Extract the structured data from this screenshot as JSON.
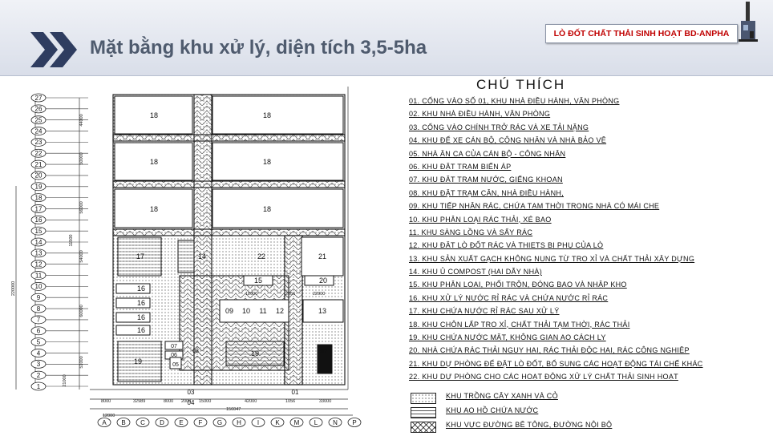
{
  "header": {
    "title": "Mặt bằng khu xử lý, diện tích 3,5-5ha",
    "badge": "LÒ ĐỐT CHẤT THẢI SINH HOẠT BD-ANPHA",
    "logo_icon": "double-chevron-icon",
    "colors": {
      "title": "#4f5b6e",
      "badge_text": "#c00000",
      "chevron": "#2f3d60"
    }
  },
  "plan": {
    "row_labels": [
      "27",
      "26",
      "25",
      "24",
      "23",
      "22",
      "21",
      "20",
      "19",
      "18",
      "17",
      "16",
      "15",
      "14",
      "13",
      "12",
      "11",
      "10",
      "9",
      "8",
      "7",
      "6",
      "5",
      "4",
      "3",
      "2",
      "1"
    ],
    "col_labels": [
      "A",
      "B",
      "C",
      "D",
      "E",
      "F",
      "G",
      "H",
      "I",
      "K",
      "M",
      "L",
      "N",
      "P"
    ],
    "vertical_dims": [
      "44000",
      "50000",
      "56000",
      "54000",
      "60000",
      "51000",
      "21000"
    ],
    "overall_height": "220000",
    "horizontal_dims": [
      "8000",
      "32989",
      "8000",
      "2000",
      "15000",
      "42000",
      "1056",
      "33000"
    ],
    "overall_width": "156047",
    "left_offset": "12000",
    "dim_12000": "12000",
    "dim_2056": "2056",
    "dim_22000": "22000",
    "zones": {
      "z18": "18",
      "z17": "17",
      "z14": "14",
      "z22": "22",
      "z21": "21",
      "z15": "15",
      "z20": "20",
      "z16": "16",
      "z09": "09",
      "z10": "10",
      "z11": "11",
      "z12": "12",
      "z13": "13",
      "z19": "19",
      "z07": "07",
      "z06": "06",
      "z05": "05",
      "z08": "08",
      "z03": "03",
      "z04": "04",
      "z02": "02",
      "z01": "01"
    }
  },
  "legend": {
    "title": "CHÚ THÍCH",
    "items": [
      "01. CỔNG VÀO SỐ 01, KHU NHÀ ĐIỀU HÀNH, VĂN PHÒNG",
      "02. KHU NHÀ ĐIỀU HÀNH, VĂN PHÒNG",
      "03. CỔNG VÀO CHÍNH TRỞ RÁC VÀ XE TẢI NẶNG",
      "04. KHU ĐỂ XE CÁN BỘ, CÔNG NHÂN VÀ NHÀ BẢO VỆ",
      "05. NHÀ ĂN CA CỦA CÁN BỘ - CÔNG NHÂN",
      "06. KHU ĐẶT TRẠM BIẾN ÁP",
      "07. KHU ĐẶT TRẠM NƯỚC, GIẾNG KHOAN",
      "08. KHU ĐẶT TRẠM CÂN, NHÀ ĐIỀU HÀNH,",
      "09. KHU TIẾP NHẬN RÁC, CHỨA TẠM THỜI TRONG NHÀ CÓ MÁI CHE",
      "10. KHU PHÂN LOẠI RÁC THẢI, XÉ BAO",
      "11. KHU SÀNG LỒNG VÀ SẤY RÁC",
      "12. KHU ĐẶT LÒ ĐỐT RÁC VÀ THIETS BỊ PHỤ CỦA LÒ",
      "13. KHU SẢN XUẤT GẠCH KHÔNG NUNG TỪ TRO XỈ VÀ CHẤT THẢI XÂY DỰNG",
      "14. KHU Ủ COMPOST (HAI DÃY NHÀ)",
      "15. KHU PHÂN LOẠI, PHỐI TRỘN, ĐÓNG BAO VÀ NHẬP KHO",
      "16. KHU XỬ LÝ NƯỚC RỈ RÁC VÀ CHỨA NƯỚC RỈ RÁC",
      "17. KHU CHỨA NƯỚC RỈ RÁC SAU XỬ LÝ",
      "18. KHU CHÔN LẤP TRO XỈ, CHẤT THẢI TẠM THỜI, RÁC THẢI",
      "19. KHU CHỨA NƯỚC MẶT, KHÔNG GIAN AO CÁCH LY",
      "20. NHÀ CHỨA RÁC THẢI NGUY HẠI, RÁC THẢI ĐỘC HẠI, RÁC CÔNG NGHIỆP",
      "21. KHU DỰ PHÒNG ĐỂ ĐẶT LÒ ĐỐT, BỔ SUNG CÁC HOẠT ĐỘNG TÁI CHẾ KHÁC",
      "22. KHU DỰ PHÒNG CHO CÁC HOẠT ĐỘNG XỬ LÝ CHẤT THẢI SINH HOẠT"
    ],
    "keys": [
      {
        "label": "KHU TRỒNG CÂY XANH VÀ CỎ",
        "pattern": "dots"
      },
      {
        "label": "KHU AO HỒ CHỨA NƯỚC",
        "pattern": "lines"
      },
      {
        "label": "KHU VỰC ĐƯỜNG BÊ TÔNG, ĐƯỜNG NỘI BỘ",
        "pattern": "zigzag"
      }
    ]
  }
}
